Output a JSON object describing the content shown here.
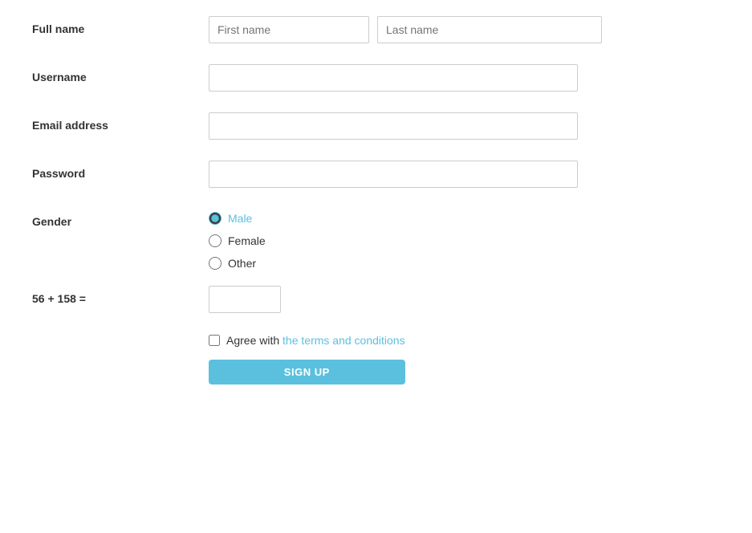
{
  "form": {
    "full_name_label": "Full name",
    "first_name_placeholder": "First name",
    "last_name_placeholder": "Last name",
    "username_label": "Username",
    "email_label": "Email address",
    "password_label": "Password",
    "gender_label": "Gender",
    "gender_options": [
      {
        "value": "male",
        "label": "Male"
      },
      {
        "value": "female",
        "label": "Female"
      },
      {
        "value": "other",
        "label": "Other"
      }
    ],
    "captcha_label": "56 + 158 =",
    "terms_text": "Agree with the terms and conditions",
    "terms_link_text": "the terms and conditions",
    "signup_label": "SIGN UP"
  }
}
